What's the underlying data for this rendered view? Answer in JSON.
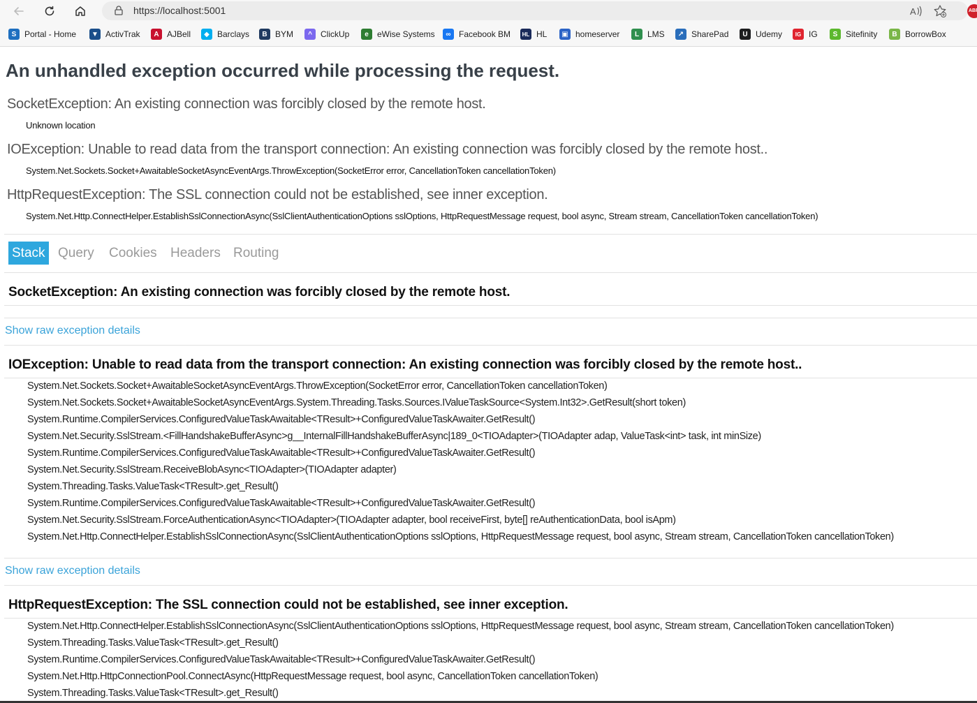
{
  "browser": {
    "url": "https://localhost:5001",
    "ext_badge": "ABP",
    "bookmarks": [
      {
        "label": "Portal - Home",
        "icon": "s-icon",
        "color": "#1e6fc0",
        "glyph": "S"
      },
      {
        "label": "ActivTrak",
        "icon": "activtrak-icon",
        "color": "#1a4e8a",
        "glyph": "▼"
      },
      {
        "label": "AJBell",
        "icon": "ajbell-icon",
        "color": "#c8102e",
        "glyph": "A"
      },
      {
        "label": "Barclays",
        "icon": "barclays-icon",
        "color": "#00aeef",
        "glyph": "◆"
      },
      {
        "label": "BYM",
        "icon": "bym-icon",
        "color": "#203a60",
        "glyph": "B"
      },
      {
        "label": "ClickUp",
        "icon": "clickup-icon",
        "color": "#7b68ee",
        "glyph": "^"
      },
      {
        "label": "eWise Systems",
        "icon": "ewise-icon",
        "color": "#2e7d32",
        "glyph": "e"
      },
      {
        "label": "Facebook BM",
        "icon": "meta-icon",
        "color": "#1877f2",
        "glyph": "∞"
      },
      {
        "label": "HL",
        "icon": "hl-icon",
        "color": "#1a2a5a",
        "glyph": "HL"
      },
      {
        "label": "homeserver",
        "icon": "homeserver-icon",
        "color": "#2b63c6",
        "glyph": "▣"
      },
      {
        "label": "LMS",
        "icon": "lms-icon",
        "color": "#2f8f4e",
        "glyph": "L"
      },
      {
        "label": "SharePad",
        "icon": "sharepad-icon",
        "color": "#2a6ebb",
        "glyph": "↗"
      },
      {
        "label": "Udemy",
        "icon": "udemy-icon",
        "color": "#1c1d1f",
        "glyph": "U"
      },
      {
        "label": "IG",
        "icon": "ig-icon",
        "color": "#e0242f",
        "glyph": "IG"
      },
      {
        "label": "Sitefinity",
        "icon": "sitefinity-icon",
        "color": "#5cb82e",
        "glyph": "S"
      },
      {
        "label": "BorrowBox",
        "icon": "borrowbox-icon",
        "color": "#7ab648",
        "glyph": "B"
      }
    ]
  },
  "page": {
    "title": "An unhandled exception occurred while processing the request.",
    "summary": [
      {
        "title": "SocketException: An existing connection was forcibly closed by the remote host.",
        "location": "Unknown location"
      },
      {
        "title": "IOException: Unable to read data from the transport connection: An existing connection was forcibly closed by the remote host..",
        "location": "System.Net.Sockets.Socket+AwaitableSocketAsyncEventArgs.ThrowException(SocketError error, CancellationToken cancellationToken)"
      },
      {
        "title": "HttpRequestException: The SSL connection could not be established, see inner exception.",
        "location": "System.Net.Http.ConnectHelper.EstablishSslConnectionAsync(SslClientAuthenticationOptions sslOptions, HttpRequestMessage request, bool async, Stream stream, CancellationToken cancellationToken)"
      }
    ],
    "tabs": [
      "Stack",
      "Query",
      "Cookies",
      "Headers",
      "Routing"
    ],
    "raw_link": "Show raw exception details",
    "exceptions": [
      {
        "heading": "SocketException: An existing connection was forcibly closed by the remote host.",
        "frames": []
      },
      {
        "heading": "IOException: Unable to read data from the transport connection: An existing connection was forcibly closed by the remote host..",
        "frames": [
          "System.Net.Sockets.Socket+AwaitableSocketAsyncEventArgs.ThrowException(SocketError error, CancellationToken cancellationToken)",
          "System.Net.Sockets.Socket+AwaitableSocketAsyncEventArgs.System.Threading.Tasks.Sources.IValueTaskSource<System.Int32>.GetResult(short token)",
          "System.Runtime.CompilerServices.ConfiguredValueTaskAwaitable<TResult>+ConfiguredValueTaskAwaiter.GetResult()",
          "System.Net.Security.SslStream.<FillHandshakeBufferAsync>g__InternalFillHandshakeBufferAsync|189_0<TIOAdapter>(TIOAdapter adap, ValueTask<int> task, int minSize)",
          "System.Runtime.CompilerServices.ConfiguredValueTaskAwaitable<TResult>+ConfiguredValueTaskAwaiter.GetResult()",
          "System.Net.Security.SslStream.ReceiveBlobAsync<TIOAdapter>(TIOAdapter adapter)",
          "System.Threading.Tasks.ValueTask<TResult>.get_Result()",
          "System.Runtime.CompilerServices.ConfiguredValueTaskAwaitable<TResult>+ConfiguredValueTaskAwaiter.GetResult()",
          "System.Net.Security.SslStream.ForceAuthenticationAsync<TIOAdapter>(TIOAdapter adapter, bool receiveFirst, byte[] reAuthenticationData, bool isApm)",
          "System.Net.Http.ConnectHelper.EstablishSslConnectionAsync(SslClientAuthenticationOptions sslOptions, HttpRequestMessage request, bool async, Stream stream, CancellationToken cancellationToken)"
        ]
      },
      {
        "heading": "HttpRequestException: The SSL connection could not be established, see inner exception.",
        "frames": [
          "System.Net.Http.ConnectHelper.EstablishSslConnectionAsync(SslClientAuthenticationOptions sslOptions, HttpRequestMessage request, bool async, Stream stream, CancellationToken cancellationToken)",
          "System.Threading.Tasks.ValueTask<TResult>.get_Result()",
          "System.Runtime.CompilerServices.ConfiguredValueTaskAwaitable<TResult>+ConfiguredValueTaskAwaiter.GetResult()",
          "System.Net.Http.HttpConnectionPool.ConnectAsync(HttpRequestMessage request, bool async, CancellationToken cancellationToken)",
          "System.Threading.Tasks.ValueTask<TResult>.get_Result()"
        ]
      }
    ]
  }
}
